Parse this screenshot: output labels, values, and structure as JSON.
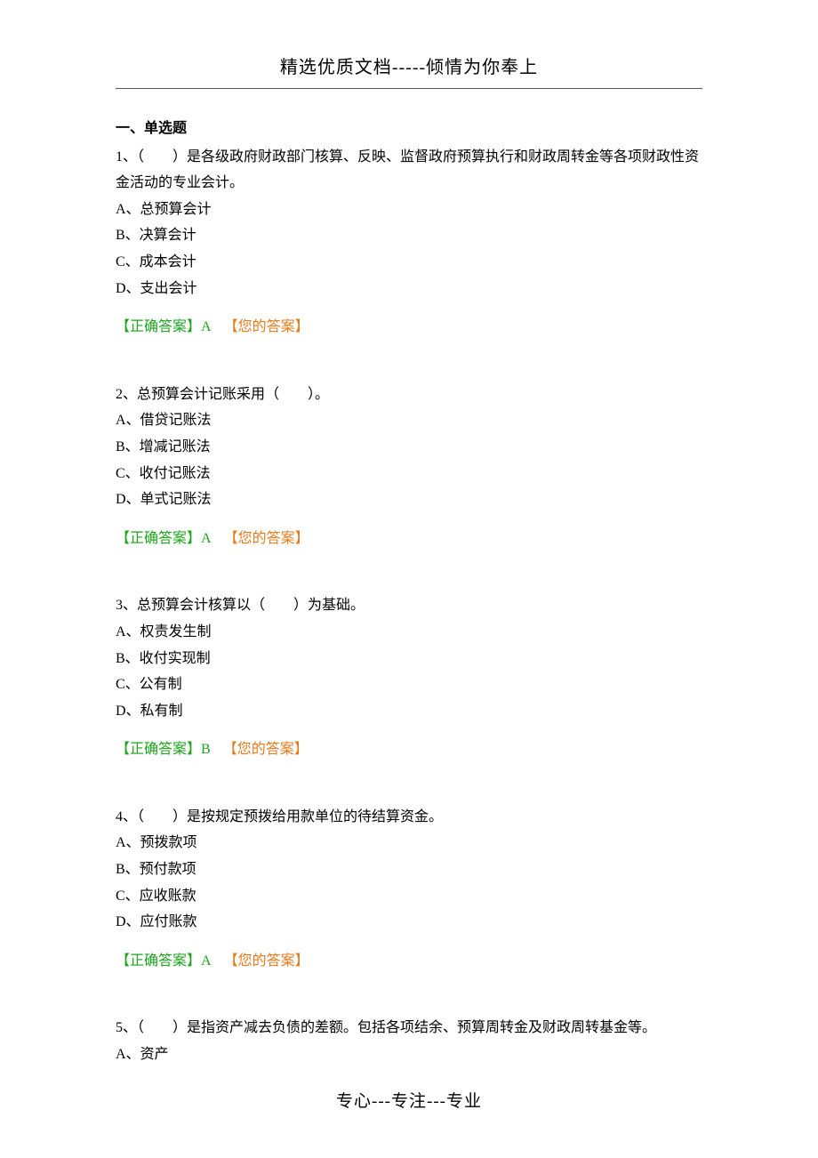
{
  "header": {
    "title": "精选优质文档-----倾情为你奉上"
  },
  "section": {
    "title": "一、单选题"
  },
  "questions": [
    {
      "number": "1、",
      "text": "（　　）是各级政府财政部门核算、反映、监督政府预算执行和财政周转金等各项财政性资金活动的专业会计。",
      "options": {
        "a": "A、总预算会计",
        "b": "B、决算会计",
        "c": "C、成本会计",
        "d": "D、支出会计"
      },
      "correct_label": "【正确答案】A",
      "your_label": "【您的答案】"
    },
    {
      "number": "2、",
      "text": "总预算会计记账采用（　　）。",
      "options": {
        "a": "A、借贷记账法",
        "b": "B、增减记账法",
        "c": "C、收付记账法",
        "d": "D、单式记账法"
      },
      "correct_label": "【正确答案】A",
      "your_label": "【您的答案】"
    },
    {
      "number": "3、",
      "text": "总预算会计核算以（　　）为基础。",
      "options": {
        "a": "A、权责发生制",
        "b": "B、收付实现制",
        "c": "C、公有制",
        "d": "D、私有制"
      },
      "correct_label": "【正确答案】B",
      "your_label": "【您的答案】"
    },
    {
      "number": "4、",
      "text": "（　　）是按规定预拨给用款单位的待结算资金。",
      "options": {
        "a": "A、预拨款项",
        "b": "B、预付款项",
        "c": "C、应收账款",
        "d": "D、应付账款"
      },
      "correct_label": "【正确答案】A",
      "your_label": "【您的答案】"
    },
    {
      "number": "5、",
      "text": "（　　）是指资产减去负债的差额。包括各项结余、预算周转金及财政周转基金等。",
      "options": {
        "a": "A、资产"
      },
      "correct_label": "",
      "your_label": ""
    }
  ],
  "footer": {
    "text": "专心---专注---专业"
  }
}
